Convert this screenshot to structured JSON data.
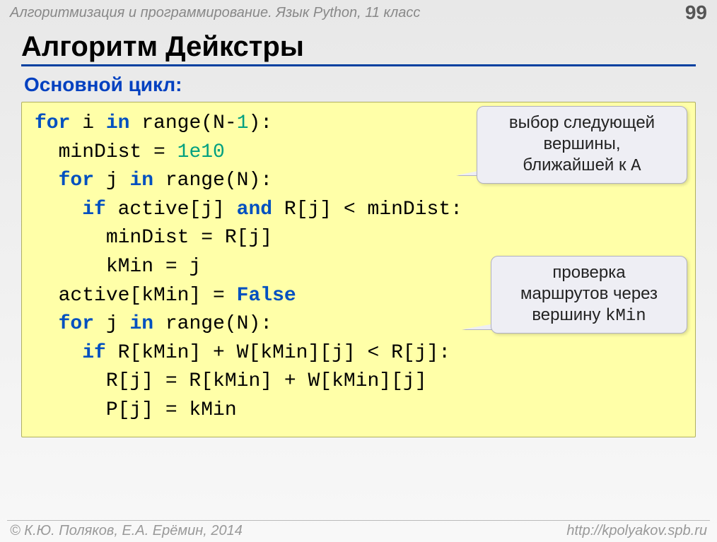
{
  "header": {
    "course": "Алгоритмизация и программирование. Язык Python, 11 класс",
    "page": "99"
  },
  "title": "Алгоритм Дейкстры",
  "subtitle": "Основной цикл:",
  "code": {
    "l1a": "for",
    "l1b": " i ",
    "l1c": "in",
    "l1d": " range(N-",
    "l1e": "1",
    "l1f": "):",
    "l2a": "  minDist = ",
    "l2b": "1e10",
    "l3a": "  ",
    "l3b": "for",
    "l3c": " j ",
    "l3d": "in",
    "l3e": " range(N):",
    "l4a": "    ",
    "l4b": "if",
    "l4c": " active[j] ",
    "l4d": "and",
    "l4e": " R[j] < minDist:",
    "l5": "      minDist = R[j]",
    "l6": "      kMin = j",
    "l7a": "  active[kMin] = ",
    "l7b": "False",
    "l8a": "  ",
    "l8b": "for",
    "l8c": " j ",
    "l8d": "in",
    "l8e": " range(N):",
    "l9a": "    ",
    "l9b": "if",
    "l9c": " R[kMin] + W[kMin][j] < R[j]:",
    "l10": "      R[j] = R[kMin] + W[kMin][j]",
    "l11": "      P[j] = kMin"
  },
  "callout1": {
    "line1": "выбор следующей",
    "line2": "вершины,",
    "line3a": "ближайшей к ",
    "line3b": "A"
  },
  "callout2": {
    "line1": "проверка",
    "line2": "маршрутов через",
    "line3a": "вершину ",
    "line3b": "kMin"
  },
  "footer": {
    "left": "© К.Ю. Поляков, Е.А. Ерёмин, 2014",
    "right": "http://kpolyakov.spb.ru"
  }
}
